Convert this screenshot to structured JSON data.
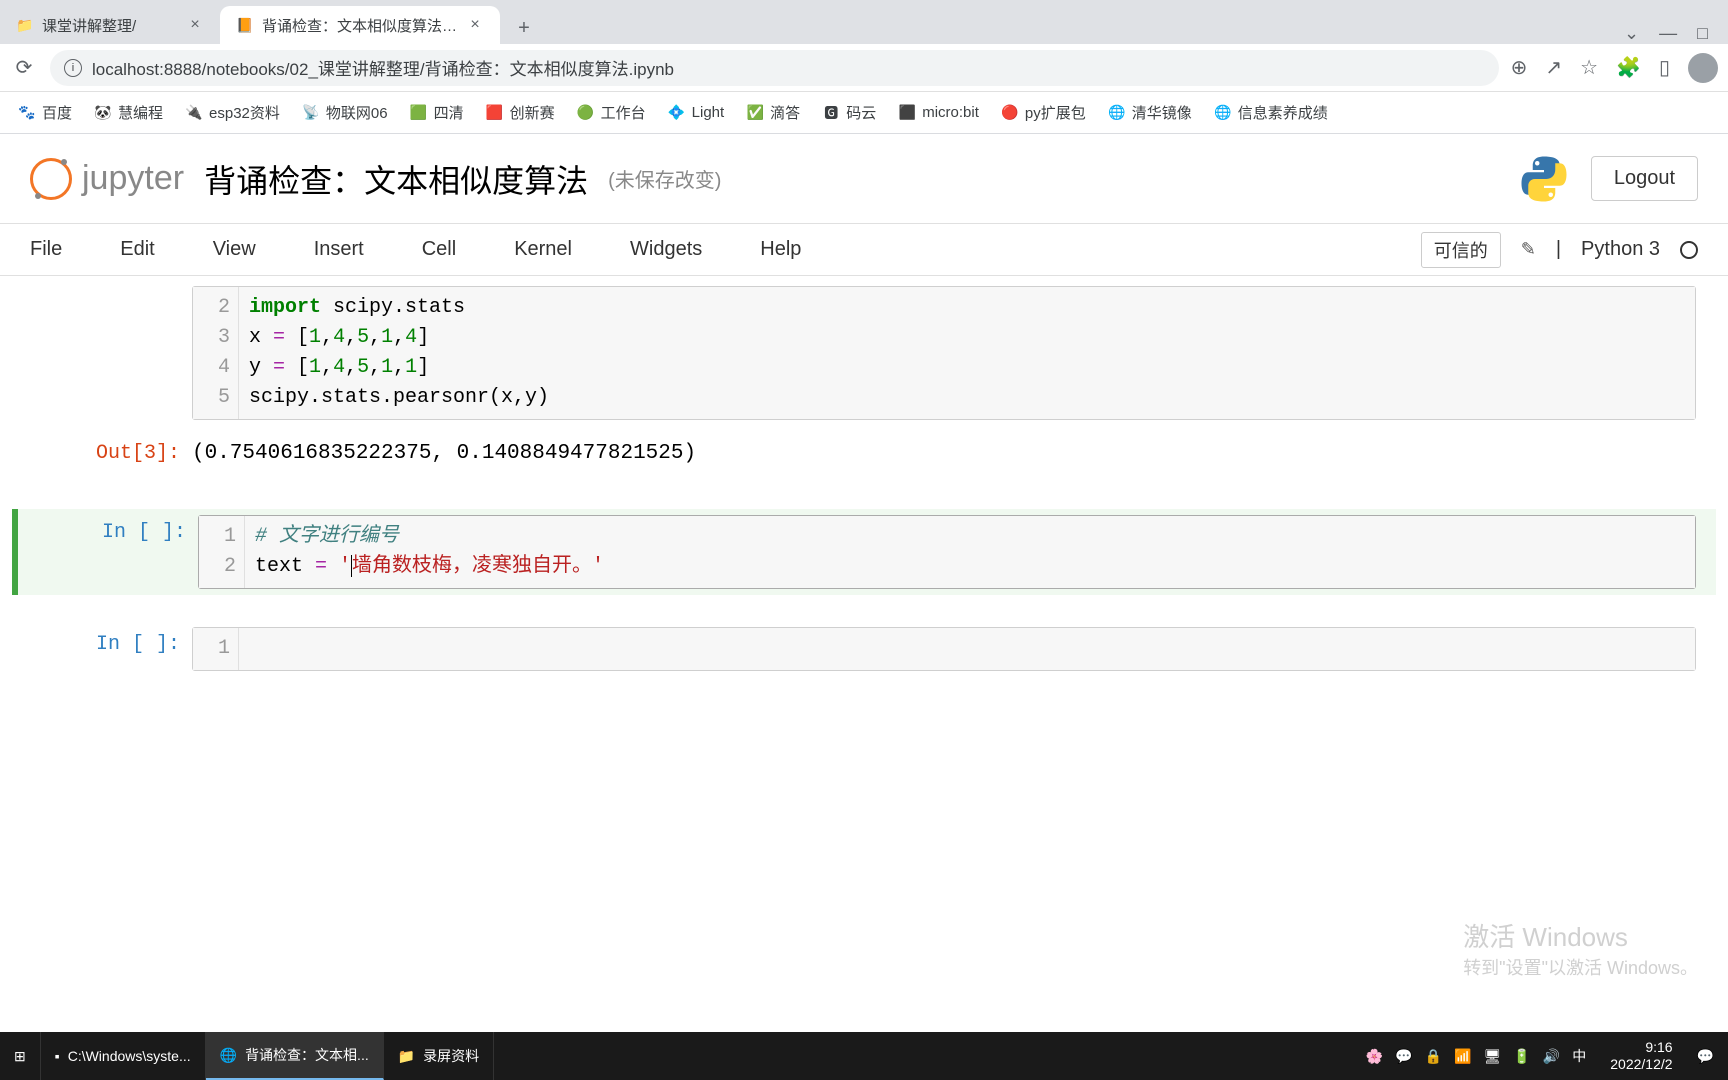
{
  "browser": {
    "tabs": [
      {
        "title": "课堂讲解整理/",
        "active": false
      },
      {
        "title": "背诵检查：文本相似度算法 - Jup",
        "active": true
      }
    ],
    "url": "localhost:8888/notebooks/02_课堂讲解整理/背诵检查：文本相似度算法.ipynb",
    "window_controls": {
      "minimize": "—",
      "restore": "□"
    }
  },
  "bookmarks": [
    "百度",
    "慧编程",
    "esp32资料",
    "物联网06",
    "四清",
    "创新赛",
    "工作台",
    "Light",
    "滴答",
    "码云",
    "micro:bit",
    "py扩展包",
    "清华镜像",
    "信息素养成绩"
  ],
  "jupyter": {
    "brand": "jupyter",
    "title": "背诵检查：文本相似度算法",
    "unsaved": "(未保存改变)",
    "logout": "Logout",
    "menu": [
      "File",
      "Edit",
      "View",
      "Insert",
      "Cell",
      "Kernel",
      "Widgets",
      "Help"
    ],
    "trust": "可信的",
    "kernel": "Python 3"
  },
  "cells": {
    "cell1": {
      "prompt": "",
      "gutter": [
        "2",
        "3",
        "4",
        "5"
      ],
      "l1_kw": "import",
      "l1_rest": " scipy.stats",
      "l2_var": "x ",
      "l2_op": "=",
      "l2_b1": " [",
      "l2_n1": "1",
      "l2_c": ",",
      "l2_n2": "4",
      "l2_n3": "5",
      "l2_n4": "1",
      "l2_n5": "4",
      "l2_b2": "]",
      "l3_var": "y ",
      "l3_op": "=",
      "l3_b1": " [",
      "l3_n1": "1",
      "l3_n2": "4",
      "l3_n3": "5",
      "l3_n4": "1",
      "l3_n5": "1",
      "l3_b2": "]",
      "l4": "scipy.stats.pearsonr(x,y)"
    },
    "out1": {
      "prompt": "Out[3]:",
      "text": "(0.7540616835222375, 0.1408849477821525)"
    },
    "cell2": {
      "prompt": "In [ ]:",
      "gutter": [
        "1",
        "2"
      ],
      "comment": "# 文字进行编号",
      "l2_var": "text ",
      "l2_op": "=",
      "l2_s1": " '",
      "l2_str": "墙角数枝梅，凌寒独自开。",
      "l2_s2": "'"
    },
    "cell3": {
      "prompt": "In [ ]:",
      "gutter": [
        "1"
      ]
    }
  },
  "watermark": {
    "line1": "激活 Windows",
    "line2": "转到\"设置\"以激活 Windows。"
  },
  "taskbar": {
    "items": [
      "C:\\Windows\\syste...",
      "背诵检查：文本相...",
      "录屏资料"
    ],
    "time": "9:16",
    "date": "2022/12/2"
  }
}
